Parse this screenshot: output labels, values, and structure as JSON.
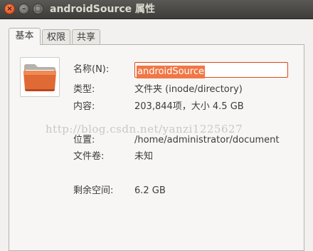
{
  "window": {
    "title": "androidSource 属性",
    "controls": {
      "close": "×",
      "minimize": "–",
      "maximize": "□"
    }
  },
  "tabs": [
    {
      "label": "基本",
      "active": true
    },
    {
      "label": "权限",
      "active": false
    },
    {
      "label": "共享",
      "active": false
    }
  ],
  "icon": {
    "name": "folder-icon",
    "color": "#dd5a2a"
  },
  "fields": {
    "name_label": "名称(N):",
    "name_value": "androidSource",
    "type_label": "类型:",
    "type_value": "文件夹 (inode/directory)",
    "contents_label": "内容:",
    "contents_value": "203,844项，大小 4.5 GB",
    "location_label": "位置:",
    "location_value": "/home/administrator/document",
    "volume_label": "文件卷:",
    "volume_value": "未知",
    "free_label": "剩余空间:",
    "free_value": "6.2 GB"
  },
  "watermark": "http://blog.csdn.net/yanzi1225627",
  "colors": {
    "accent": "#dd4814",
    "selection": "#f07746",
    "titlebar": "#3d3c38"
  }
}
